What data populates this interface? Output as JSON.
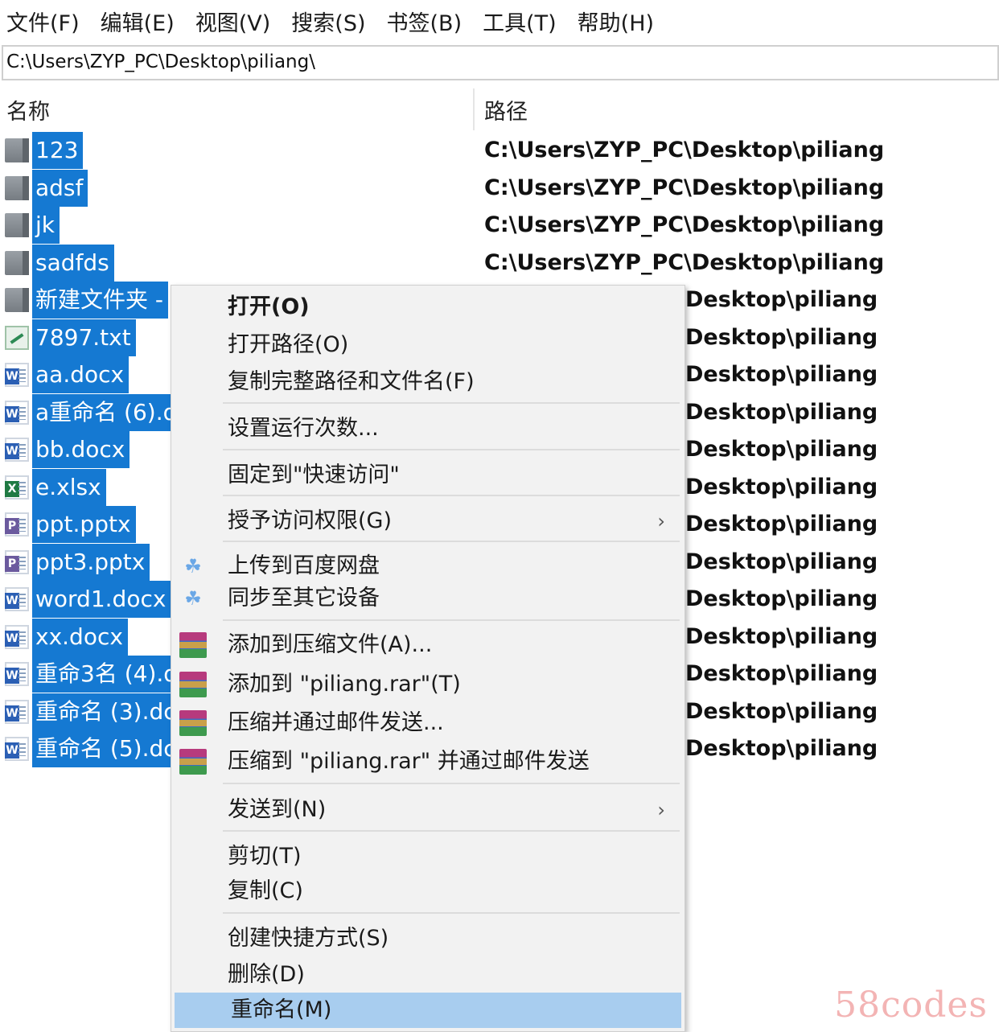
{
  "menubar": {
    "items": [
      "文件(F)",
      "编辑(E)",
      "视图(V)",
      "搜索(S)",
      "书签(B)",
      "工具(T)",
      "帮助(H)"
    ]
  },
  "pathbar": {
    "value": "C:\\Users\\ZYP_PC\\Desktop\\piliang\\"
  },
  "columns": {
    "name": "名称",
    "path": "路径"
  },
  "files": [
    {
      "name": "123",
      "type": "folder",
      "path": "C:\\Users\\ZYP_PC\\Desktop\\piliang"
    },
    {
      "name": "adsf",
      "type": "folder",
      "path": "C:\\Users\\ZYP_PC\\Desktop\\piliang"
    },
    {
      "name": "jk",
      "type": "folder",
      "path": "C:\\Users\\ZYP_PC\\Desktop\\piliang"
    },
    {
      "name": "sadfds",
      "type": "folder",
      "path": "C:\\Users\\ZYP_PC\\Desktop\\piliang"
    },
    {
      "name": "新建文件夹 -",
      "type": "folder",
      "path": "Desktop\\piliang"
    },
    {
      "name": "7897.txt",
      "type": "txt",
      "path": "Desktop\\piliang"
    },
    {
      "name": "aa.docx",
      "type": "word",
      "path": "Desktop\\piliang"
    },
    {
      "name": "a重命名 (6).d",
      "type": "word",
      "path": "Desktop\\piliang"
    },
    {
      "name": "bb.docx",
      "type": "word",
      "path": "Desktop\\piliang"
    },
    {
      "name": "e.xlsx",
      "type": "excel",
      "path": "Desktop\\piliang"
    },
    {
      "name": "ppt.pptx",
      "type": "ppt",
      "path": "Desktop\\piliang"
    },
    {
      "name": "ppt3.pptx",
      "type": "ppt",
      "path": "Desktop\\piliang"
    },
    {
      "name": "word1.docx",
      "type": "word",
      "path": "Desktop\\piliang"
    },
    {
      "name": "xx.docx",
      "type": "word",
      "path": "Desktop\\piliang"
    },
    {
      "name": "重命3名 (4).d",
      "type": "word",
      "path": "Desktop\\piliang"
    },
    {
      "name": "重命名 (3).dc",
      "type": "word",
      "path": "Desktop\\piliang"
    },
    {
      "name": "重命名 (5).dc",
      "type": "word",
      "path": "Desktop\\piliang"
    }
  ],
  "context_menu": {
    "items": [
      {
        "label": "打开(O)",
        "bold": true
      },
      {
        "label": "打开路径(O)"
      },
      {
        "label": "复制完整路径和文件名(F)"
      },
      {
        "label": "设置运行次数..."
      },
      {
        "label": "固定到\"快速访问\""
      },
      {
        "label": "授予访问权限(G)",
        "submenu": true
      },
      {
        "label": "上传到百度网盘",
        "icon": "baidu-cloud-icon"
      },
      {
        "label": "同步至其它设备",
        "icon": "baidu-cloud-icon"
      },
      {
        "label": "添加到压缩文件(A)...",
        "icon": "winrar-icon"
      },
      {
        "label": "添加到 \"piliang.rar\"(T)",
        "icon": "winrar-icon"
      },
      {
        "label": "压缩并通过邮件发送...",
        "icon": "winrar-icon"
      },
      {
        "label": "压缩到 \"piliang.rar\" 并通过邮件发送",
        "icon": "winrar-icon"
      },
      {
        "label": "发送到(N)",
        "submenu": true
      },
      {
        "label": "剪切(T)"
      },
      {
        "label": "复制(C)"
      },
      {
        "label": "创建快捷方式(S)"
      },
      {
        "label": "删除(D)"
      },
      {
        "label": "重命名(M)",
        "highlighted": true
      }
    ],
    "submenu_arrow": "›"
  },
  "colors": {
    "selection": "#1579d2",
    "menu_bg": "#f2f2f2",
    "menu_highlight": "#a8cdef"
  },
  "watermark": "58codes"
}
